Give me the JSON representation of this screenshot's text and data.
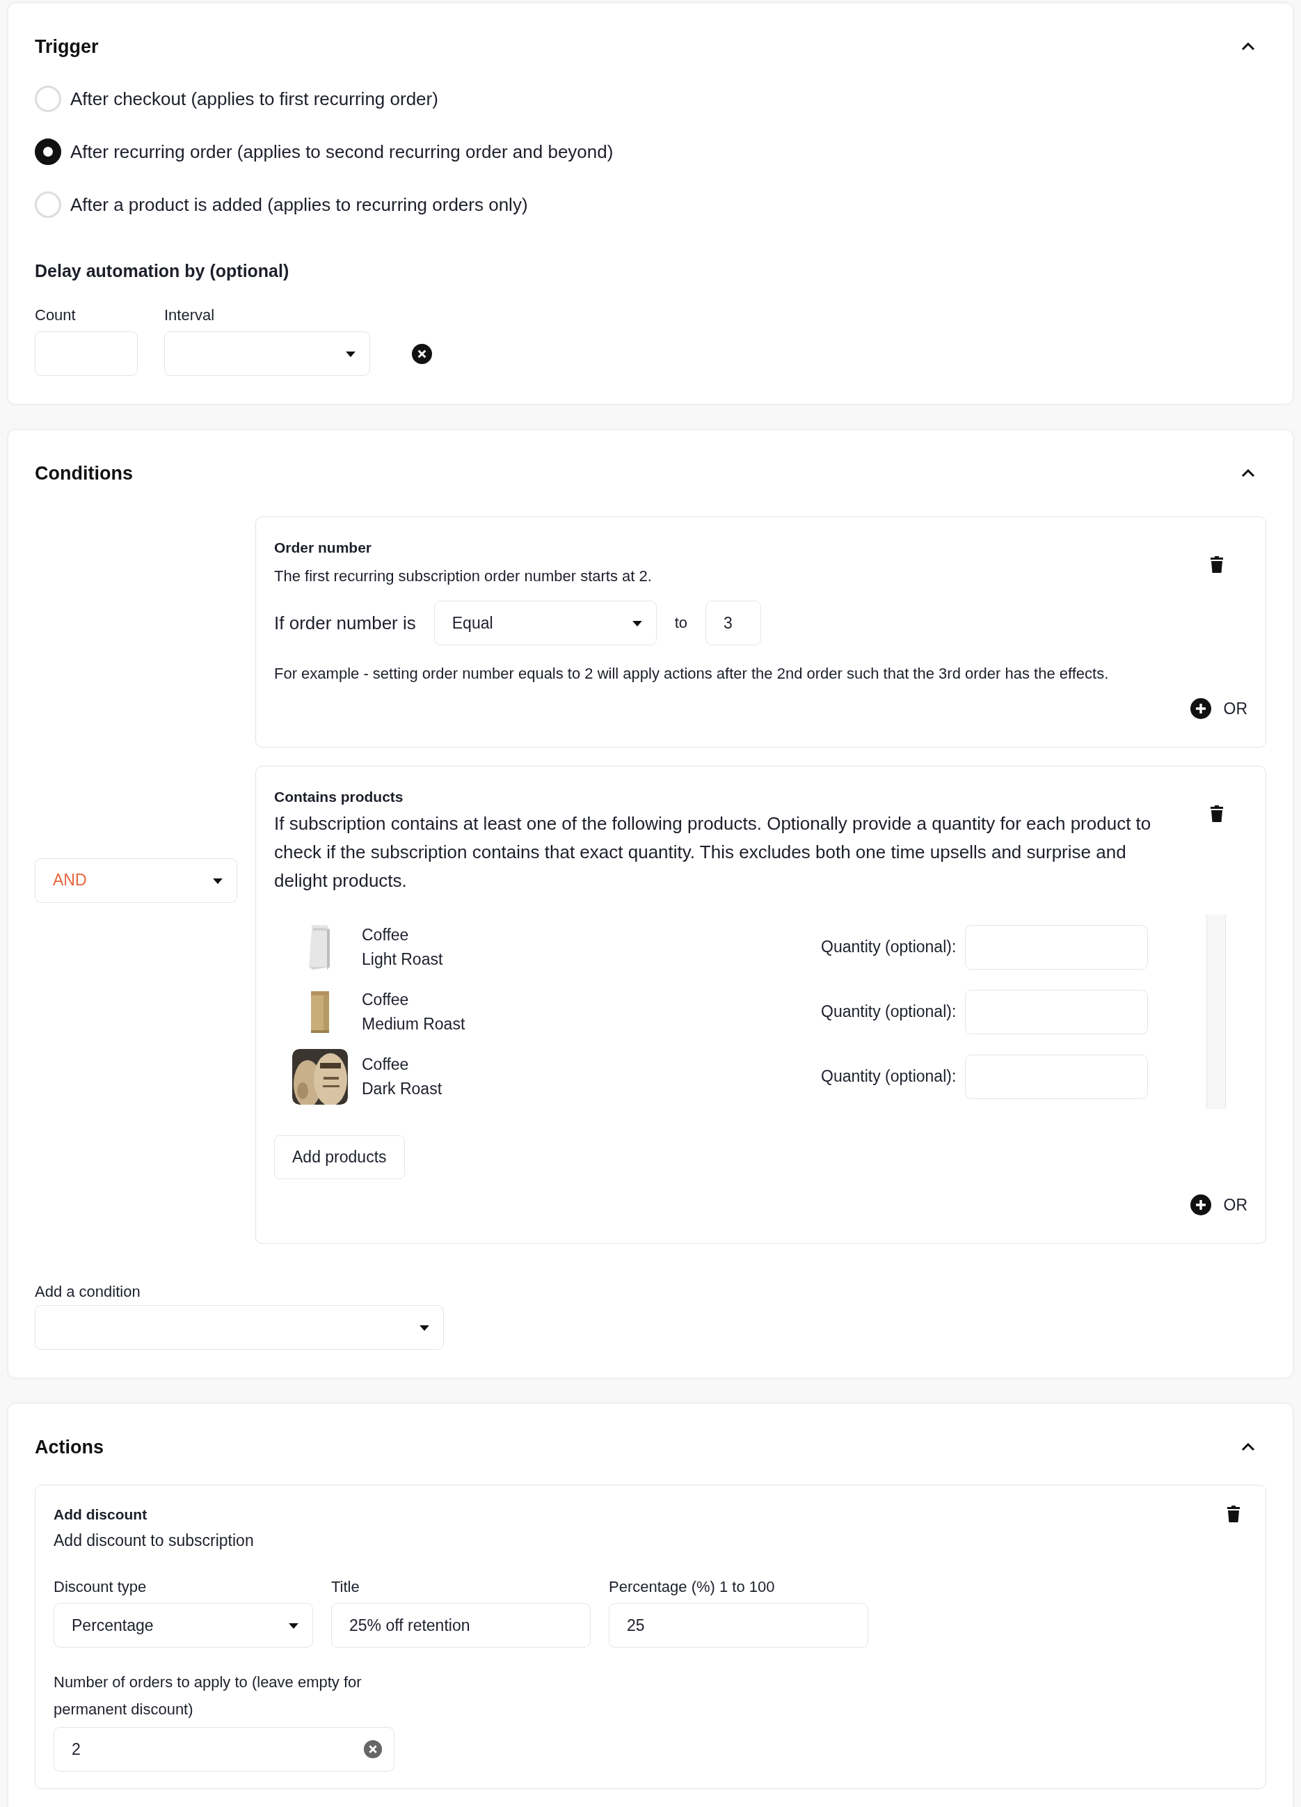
{
  "trigger": {
    "title": "Trigger",
    "expanded": true,
    "options": [
      {
        "label": "After checkout (applies to first recurring order)",
        "selected": false
      },
      {
        "label": "After recurring order (applies to second recurring order and beyond)",
        "selected": true
      },
      {
        "label": "After a product is added (applies to recurring orders only)",
        "selected": false
      }
    ],
    "delay": {
      "title": "Delay automation by (optional)",
      "count_label": "Count",
      "interval_label": "Interval"
    }
  },
  "conditions": {
    "title": "Conditions",
    "expanded": true,
    "operator": "AND",
    "items": [
      {
        "kind": "order_number",
        "title": "Order number",
        "description": "The first recurring subscription order number starts at 2.",
        "prompt": "If order number is",
        "comparator": "Equal",
        "to_label": "to",
        "value": "3",
        "example": "For example - setting order number equals to 2 will apply actions after the 2nd order such that the 3rd order has the effects.",
        "or_label": "OR"
      },
      {
        "kind": "products",
        "title": "Contains products",
        "description": "If subscription contains at least one of the following products. Optionally provide a quantity for each product to check if the subscription contains that exact quantity. This excludes both one time upsells and surprise and delight products.",
        "products": [
          {
            "name": "Coffee",
            "variant": "Light Roast",
            "quantity_label": "Quantity (optional):"
          },
          {
            "name": "Coffee",
            "variant": "Medium Roast",
            "quantity_label": "Quantity (optional):"
          },
          {
            "name": "Coffee",
            "variant": "Dark Roast",
            "quantity_label": "Quantity (optional):"
          }
        ],
        "add_button": "Add products",
        "or_label": "OR"
      }
    ],
    "add_label": "Add a condition"
  },
  "actions": {
    "title": "Actions",
    "expanded": true,
    "items": [
      {
        "title": "Add discount",
        "description": "Add discount to subscription",
        "discount_type_label": "Discount type",
        "discount_type": "Percentage",
        "title_label": "Title",
        "title_value": "25% off retention",
        "percentage_label": "Percentage (%) 1 to 100",
        "percentage_value": "25",
        "orders_label": "Number of orders to apply to (leave empty for permanent discount)",
        "orders_value": "2"
      }
    ]
  }
}
